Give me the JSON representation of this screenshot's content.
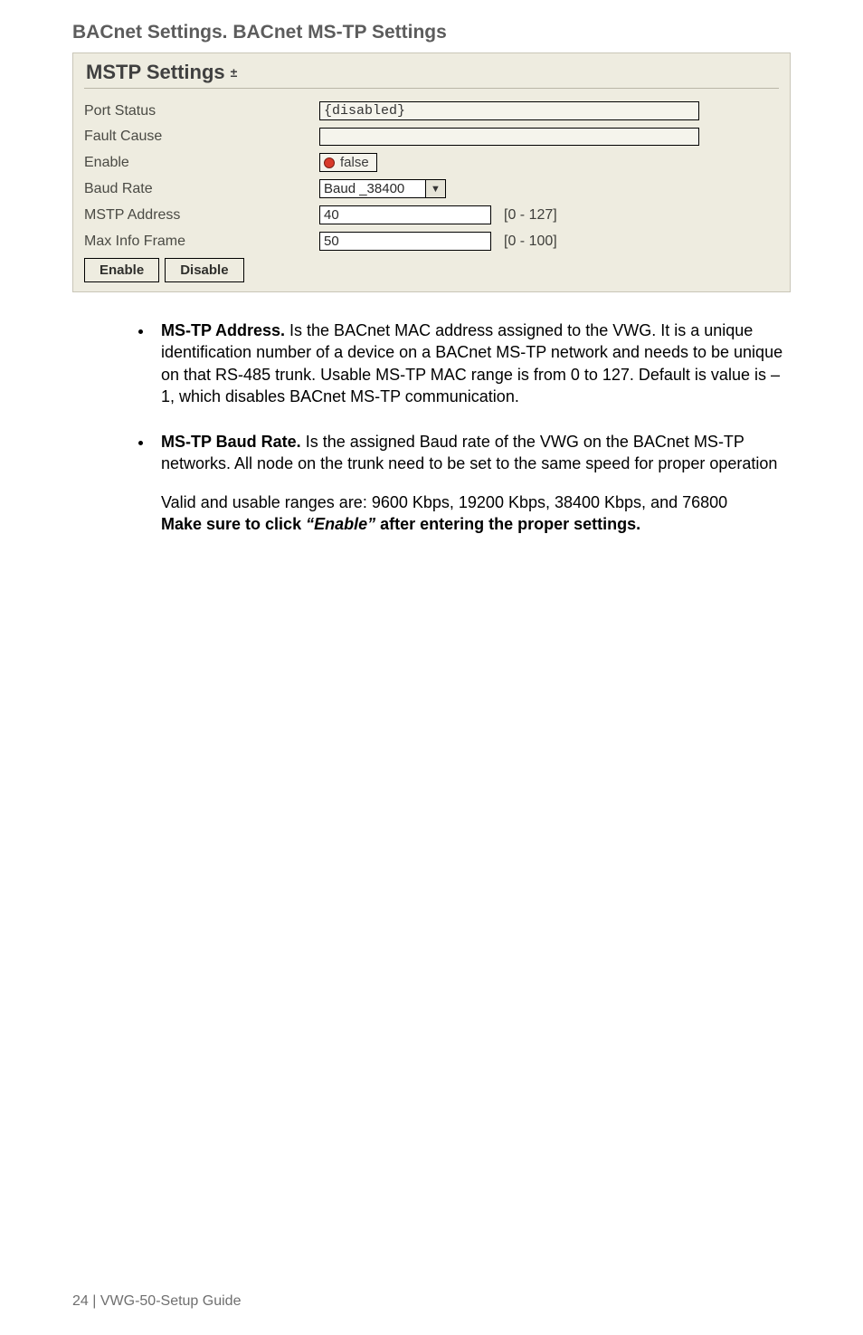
{
  "heading": "BACnet Settings. BACnet MS-TP Settings",
  "panel": {
    "title": "MSTP Settings",
    "collapse_glyph": "±",
    "rows": {
      "port_status": {
        "label": "Port Status",
        "value": "{disabled}"
      },
      "fault_cause": {
        "label": "Fault Cause",
        "value": ""
      },
      "enable": {
        "label": "Enable",
        "value": "false"
      },
      "baud_rate": {
        "label": "Baud Rate",
        "value": "Baud _38400"
      },
      "mstp_address": {
        "label": "MSTP Address",
        "value": "40",
        "range": "[0 - 127]"
      },
      "max_info": {
        "label": "Max Info Frame",
        "value": "50",
        "range": "[0 - 100]"
      }
    },
    "buttons": {
      "enable": "Enable",
      "disable": "Disable"
    }
  },
  "bullets": {
    "b1_title": "MS-TP Address.",
    "b1_body": " Is the BACnet MAC address assigned to the VWG. It is a unique identification number of a device on a BACnet MS-TP network and needs to be unique on that RS-485 trunk. Usable MS-TP MAC range is from 0 to 127. Default is value is –1, which disables BACnet MS-TP communication.",
    "b2_title": "MS-TP Baud Rate.",
    "b2_body": " Is the assigned Baud rate of the VWG on the BACnet MS-TP networks. All node on the trunk need to be set to the same speed for proper operation",
    "b2_p2a": "Valid and usable ranges are: 9600 Kbps, 19200 Kbps, 38400 Kbps, and 76800",
    "b2_p2b_prefix": "Make sure to click ",
    "b2_p2b_em": "“Enable”",
    "b2_p2b_suffix": " after entering the proper settings."
  },
  "footer": "24 | VWG-50-Setup Guide"
}
